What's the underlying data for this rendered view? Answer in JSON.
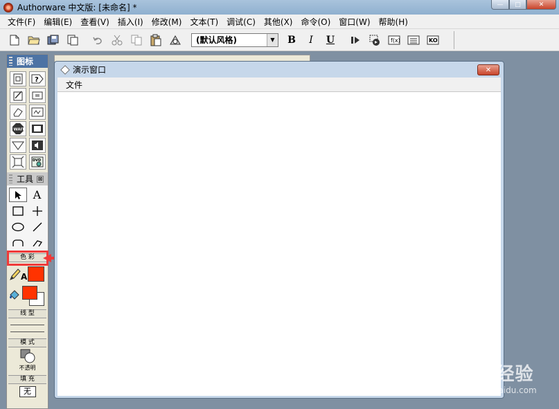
{
  "app": {
    "title": "Authorware 中文版: [未命名] *"
  },
  "window_controls": {
    "minimize": "—",
    "maximize": "□",
    "close": "✕"
  },
  "menubar": {
    "items": [
      "文件(F)",
      "编辑(E)",
      "查看(V)",
      "插入(I)",
      "修改(M)",
      "文本(T)",
      "调试(C)",
      "其他(X)",
      "命令(O)",
      "窗口(W)",
      "帮助(H)"
    ]
  },
  "toolbar": {
    "style_select": "(默认风格)",
    "bold": "B",
    "italic": "I",
    "underline": "U"
  },
  "icon_palette": {
    "title": "图标"
  },
  "tools_panel": {
    "title": "工具",
    "close_label": "⊠",
    "text_tool": "A",
    "color_section": "色 彩",
    "line_section": "线 型",
    "mode_section": "模 式",
    "mode_value": "不透明",
    "fill_section": "填 充",
    "fill_value": "无",
    "colors": {
      "line_text_color": "#ff3300",
      "fill_fg_color": "#ff3300",
      "fill_bg_color": "#ffffff"
    }
  },
  "presentation_window": {
    "title": "演示窗口",
    "menu_file": "文件",
    "close": "✕"
  },
  "annotation": {
    "highlight_color": "#f03a3a"
  },
  "watermark": {
    "brand": "Baidu 经验",
    "url": "jingyan.baidu.com"
  }
}
